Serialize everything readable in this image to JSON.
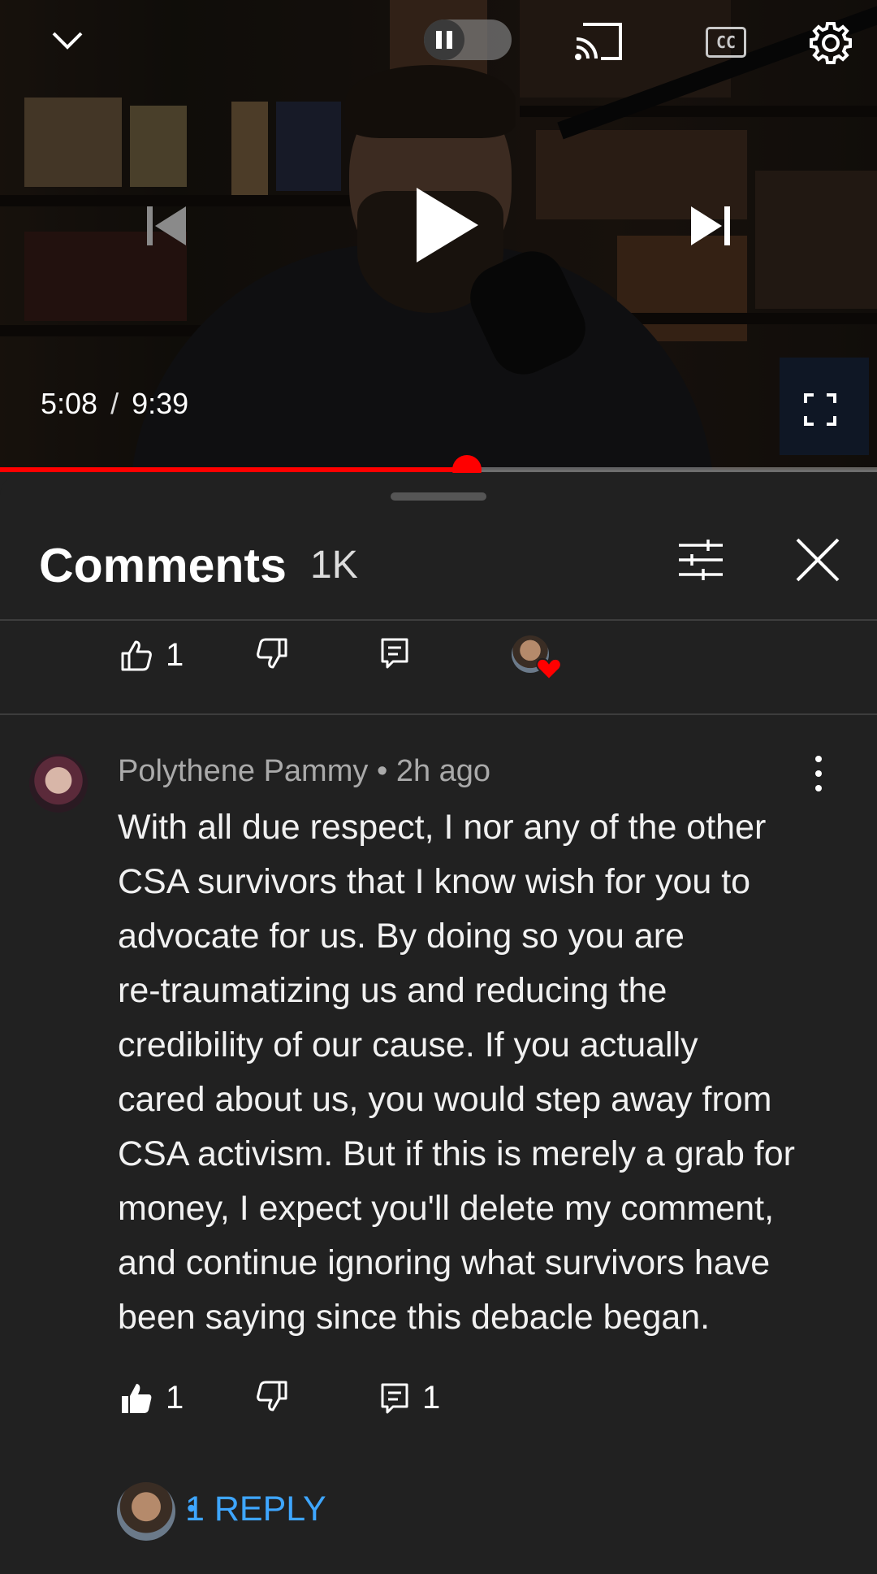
{
  "player": {
    "current_time": "5:08",
    "separator": "/",
    "duration": "9:39",
    "progress": 0.532,
    "icons": {
      "minimize": "chevron-down-icon",
      "autoplay": "autoplay-toggle-icon",
      "cast": "cast-icon",
      "captions": "cc-icon",
      "settings": "gear-icon",
      "previous": "skip-previous-icon",
      "play": "play-icon",
      "next": "skip-next-icon",
      "fullscreen": "fullscreen-icon"
    },
    "captions_label": "CC"
  },
  "comments_panel": {
    "title": "Comments",
    "count": "1K",
    "icons": {
      "filter": "sliders-icon",
      "close": "close-icon"
    },
    "previous_comment_actions": {
      "like_count": "1",
      "icons": [
        "thumbs-up-icon",
        "thumbs-down-icon",
        "reply-comment-icon",
        "creator-heart-badge-icon"
      ]
    },
    "comment": {
      "author": "Polythene Pammy",
      "time": "2h ago",
      "body_lines": [
        "With all due respect, I nor any of the other",
        "CSA survivors that I know wish for you to",
        "advocate for us. By doing so you are",
        "re-traumatizing us and reducing the",
        "credibility of our cause. If you actually",
        "cared about us, you would step away from",
        "CSA activism. But if this is merely a grab for",
        "money,  I expect you'll delete my comment,",
        "and continue ignoring what survivors have",
        "been saying since this debacle began."
      ],
      "like_count": "1",
      "reply_count": "1",
      "replies_link": "1 REPLY",
      "icons": [
        "thumbs-up-filled-icon",
        "thumbs-down-icon",
        "reply-comment-icon",
        "more-vert-icon"
      ]
    }
  },
  "colors": {
    "background": "#212121",
    "progress": "#ff0000",
    "link": "#3ea6ff",
    "meta_text": "#aaaaaa"
  }
}
